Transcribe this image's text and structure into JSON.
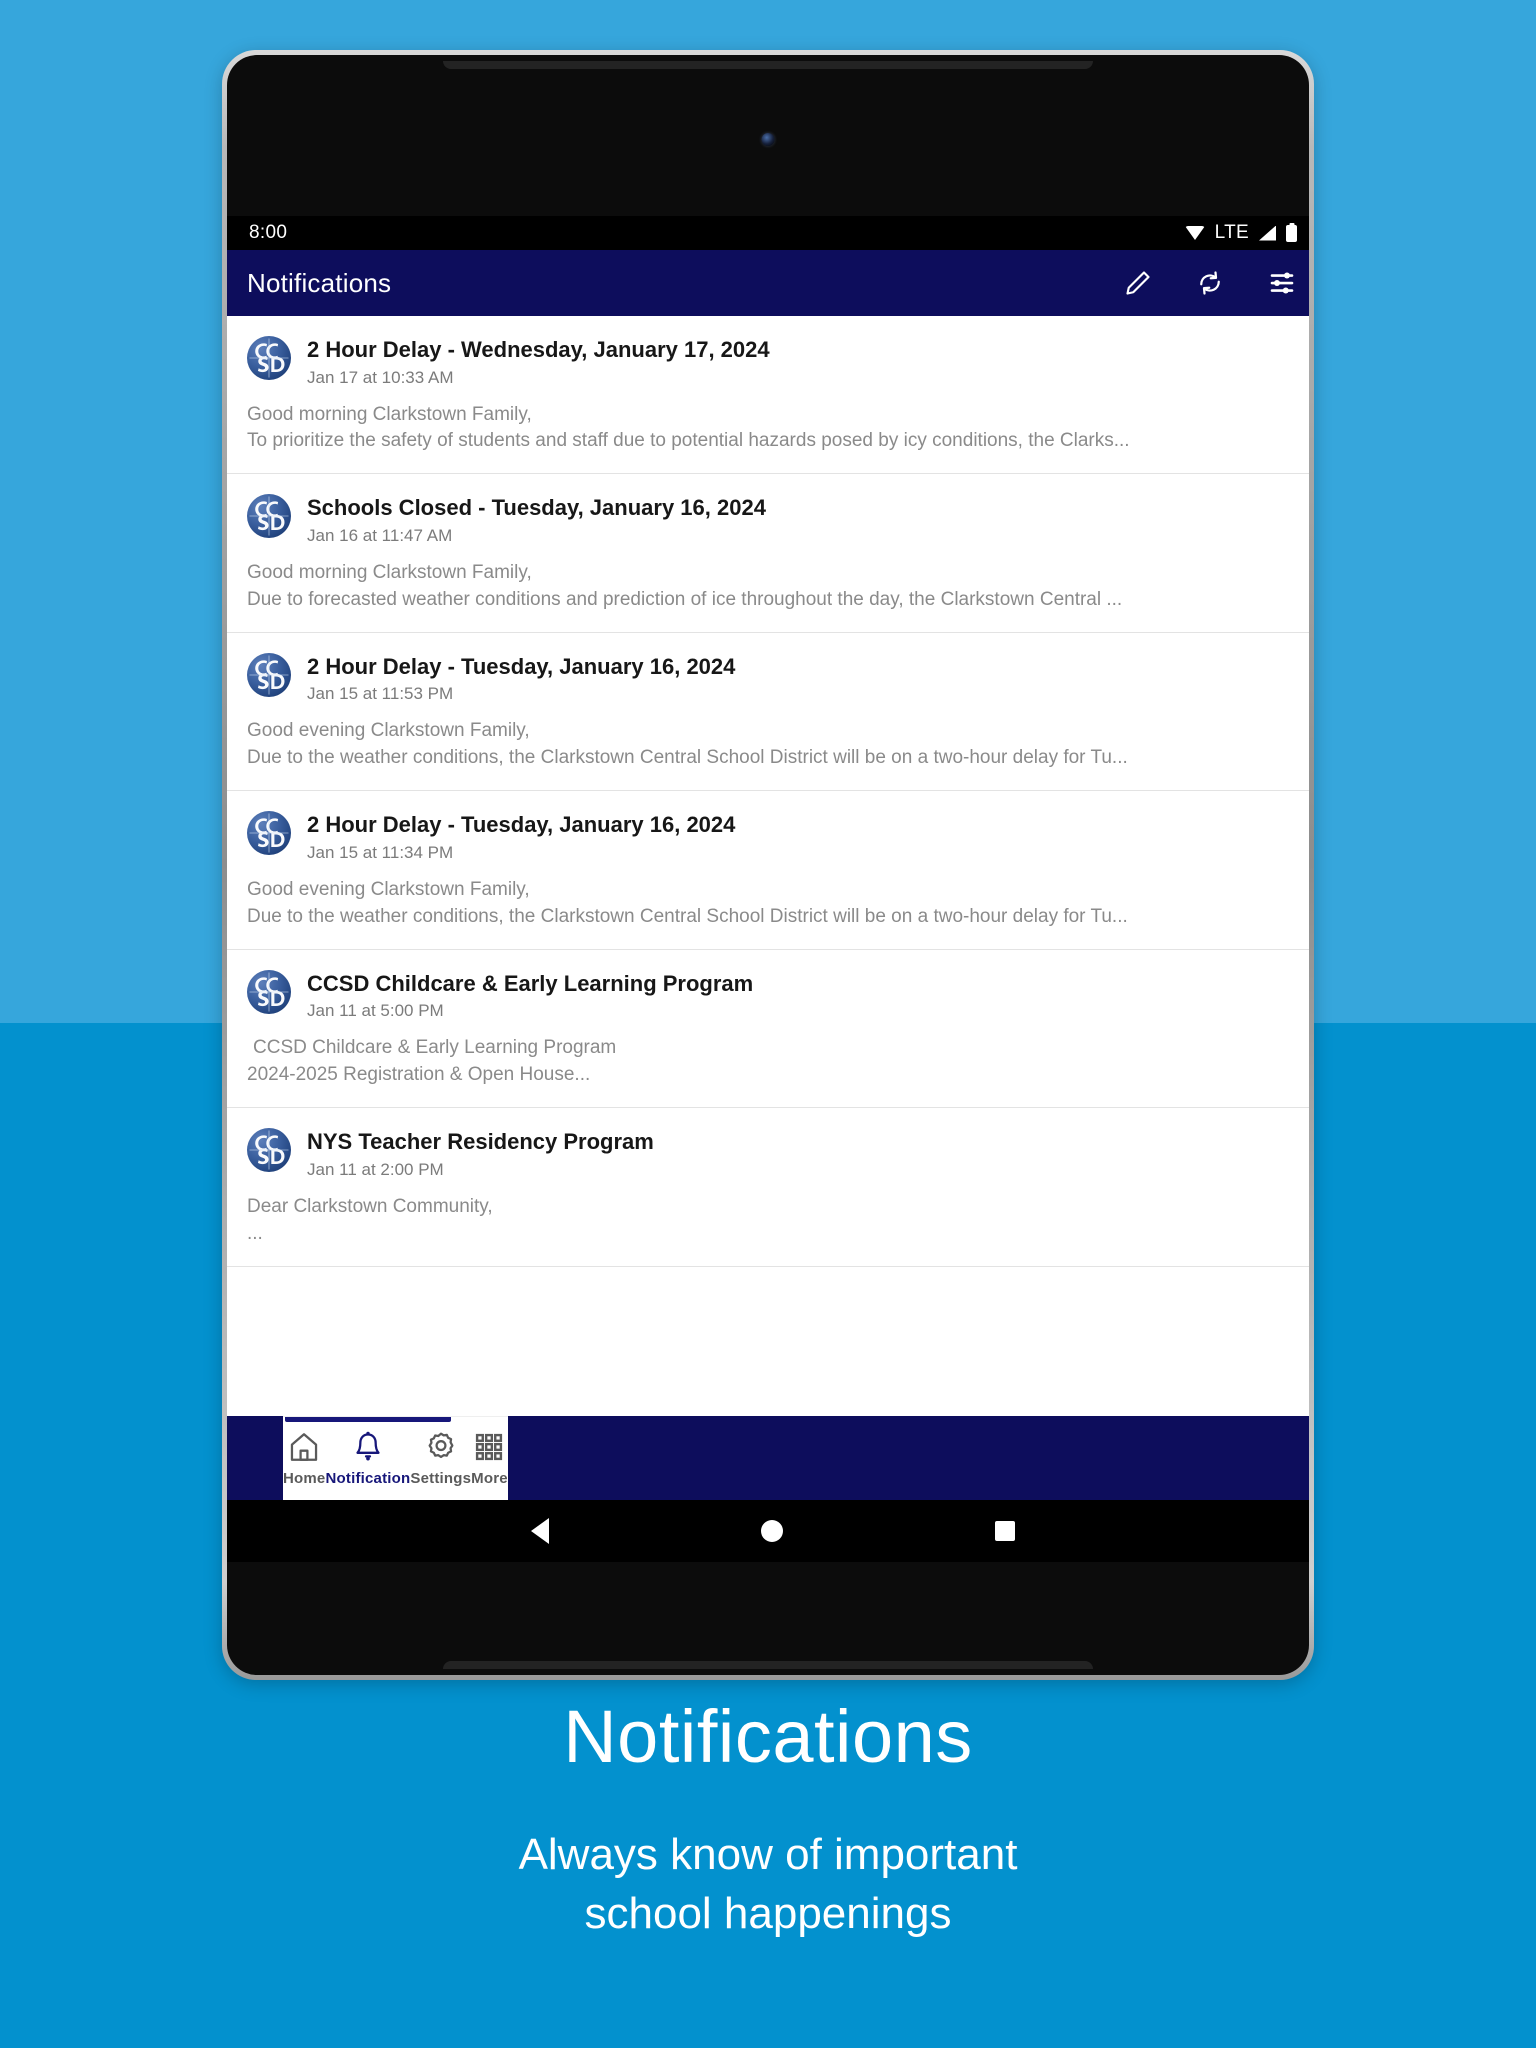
{
  "background": {
    "top_color": "#36a6dc",
    "bottom_color": "#0391ce"
  },
  "status_bar": {
    "time": "8:00",
    "network_label": "LTE",
    "icons": [
      "wifi-icon",
      "signal-icon",
      "battery-icon"
    ]
  },
  "app_bar": {
    "title": "Notifications",
    "background": "#0d0d5c",
    "actions": [
      {
        "name": "compose-pencil-icon",
        "label": "Compose"
      },
      {
        "name": "refresh-icon",
        "label": "Refresh"
      },
      {
        "name": "filter-tune-icon",
        "label": "Filter"
      }
    ]
  },
  "notifications": [
    {
      "avatar": "ccsd-logo-avatar",
      "title": "2 Hour Delay - Wednesday, January 17, 2024",
      "time": "Jan 17 at 10:33 AM",
      "line1": "Good morning Clarkstown Family,",
      "line2": "To prioritize the safety of students and staff due to potential hazards posed by icy conditions, the Clarks...",
      "indent": false
    },
    {
      "avatar": "ccsd-logo-avatar",
      "title": "Schools Closed - Tuesday, January 16, 2024",
      "time": "Jan 16 at 11:47 AM",
      "line1": "Good morning Clarkstown Family,",
      "line2": "Due to forecasted weather conditions and prediction of ice throughout the day, the Clarkstown Central ...",
      "indent": false
    },
    {
      "avatar": "ccsd-logo-avatar",
      "title": "2 Hour Delay - Tuesday, January 16, 2024",
      "time": "Jan 15 at 11:53 PM",
      "line1": "Good evening Clarkstown Family,",
      "line2": "Due to the weather conditions, the Clarkstown Central School District will be on a two-hour delay for Tu...",
      "indent": false
    },
    {
      "avatar": "ccsd-logo-avatar",
      "title": "2 Hour Delay - Tuesday, January 16, 2024",
      "time": "Jan 15 at 11:34 PM",
      "line1": "Good evening Clarkstown Family,",
      "line2": "Due to the weather conditions, the Clarkstown Central School District will be on a two-hour delay for Tu...",
      "indent": false
    },
    {
      "avatar": "ccsd-logo-avatar",
      "title": "CCSD Childcare & Early Learning Program",
      "time": "Jan 11 at 5:00 PM",
      "line1": " CCSD Childcare & Early Learning Program",
      "line2": "2024-2025 Registration & Open House...",
      "indent": true
    },
    {
      "avatar": "ccsd-logo-avatar",
      "title": "NYS Teacher Residency Program",
      "time": "Jan 11 at 2:00 PM",
      "line1": "Dear Clarkstown Community,",
      "line2": "...",
      "indent": false
    }
  ],
  "bottom_nav": {
    "active_index": 1,
    "items": [
      {
        "icon": "home-icon",
        "label": "Home"
      },
      {
        "icon": "bell-icon",
        "label": "Notification"
      },
      {
        "icon": "gear-icon",
        "label": "Settings"
      },
      {
        "icon": "grid-more-icon",
        "label": "More"
      }
    ]
  },
  "android_nav": {
    "buttons": [
      "back-triangle-icon",
      "home-circle-icon",
      "recents-square-icon"
    ]
  },
  "caption": {
    "title": "Notifications",
    "subtitle_line1": "Always know of important",
    "subtitle_line2": "school happenings"
  }
}
